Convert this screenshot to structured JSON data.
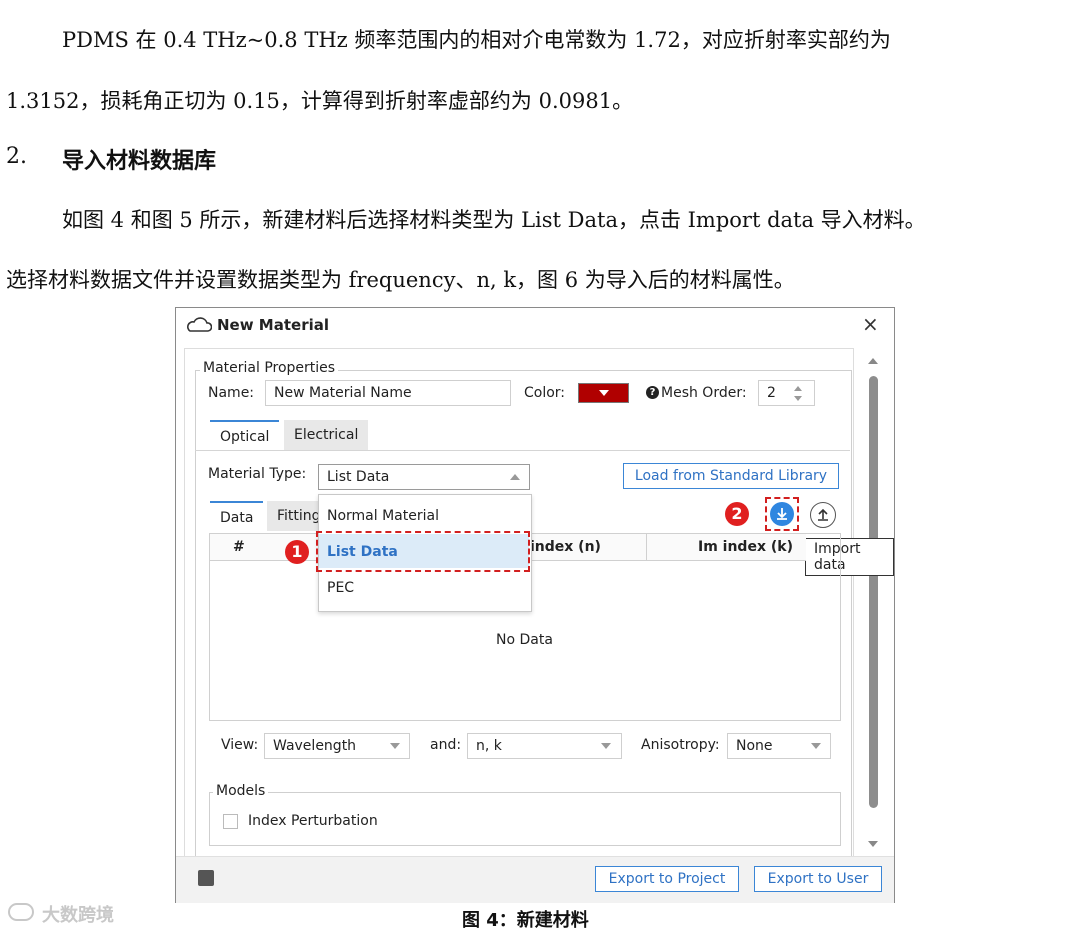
{
  "doc": {
    "line1": "PDMS 在 0.4 THz~0.8 THz 频率范围内的相对介电常数为 1.72，对应折射率实部约为",
    "line2": "1.3152，损耗角正切为 0.15，计算得到折射率虚部约为 0.0981。",
    "heading_num": "2.",
    "heading": "导入材料数据库",
    "line3": "如图 4 和图 5 所示，新建材料后选择材料类型为 List Data，点击 Import data 导入材料。",
    "line4": "选择材料数据文件并设置数据类型为 frequency、n, k，图 6 为导入后的材料属性。",
    "caption": "图 4：新建材料",
    "watermark": "大数跨境"
  },
  "dialog": {
    "title": "New Material",
    "close_icon": "×",
    "material_properties_label": "Material Properties",
    "name_label": "Name:",
    "name_value": "New Material Name",
    "color_label": "Color:",
    "color_value": "#b00000",
    "mesh_order_label": "Mesh Order:",
    "mesh_order_value": "2",
    "tabs": {
      "optical": "Optical",
      "electrical": "Electrical"
    },
    "material_type_label": "Material Type:",
    "material_type_value": "List Data",
    "load_library_button": "Load from Standard Library",
    "subtabs": {
      "data": "Data",
      "fitting": "Fitting"
    },
    "table": {
      "col_index": "#",
      "col_re": "index (n)",
      "col_im": "Im index (k)",
      "empty": "No Data"
    },
    "dropdown_options": [
      "Normal Material",
      "List Data",
      "PEC"
    ],
    "annotation_1": "1",
    "annotation_2": "2",
    "import_tooltip": "Import data",
    "view_label": "View:",
    "view_value": "Wavelength",
    "and_label": "and:",
    "and_value": "n, k",
    "anisotropy_label": "Anisotropy:",
    "anisotropy_value": "None",
    "models_label": "Models",
    "index_perturbation_label": "Index Perturbation",
    "export_project_button": "Export to Project",
    "export_user_button": "Export to User"
  }
}
